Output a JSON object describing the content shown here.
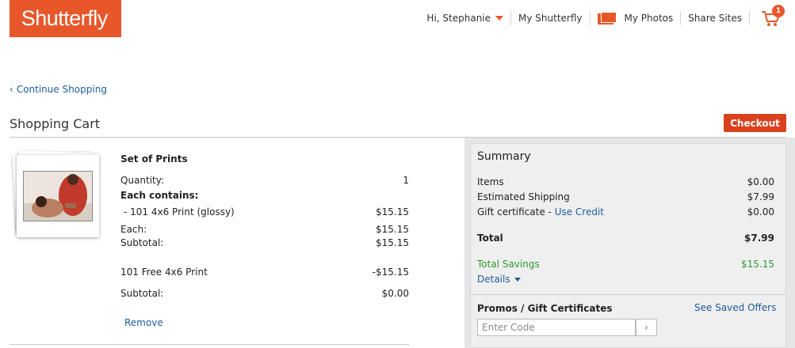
{
  "header": {
    "logo_text": "Shutterfly",
    "logo_mark": ".",
    "greeting": "Hi, Stephanie",
    "my_shutterfly": "My Shutterfly",
    "my_photos": "My Photos",
    "share_sites": "Share Sites",
    "cart_count": "1"
  },
  "continue_shopping": "Continue Shopping",
  "page_title": "Shopping Cart",
  "checkout_label": "Checkout",
  "item": {
    "title": "Set of Prints",
    "quantity_label": "Quantity:",
    "quantity_value": "1",
    "each_contains_label": "Each contains:",
    "line_label": "- 101 4x6 Print (glossy)",
    "line_value": "$15.15",
    "each_label": "Each:",
    "each_value": "$15.15",
    "subtotal_label": "Subtotal:",
    "subtotal_value": "$15.15",
    "free_label": "101 Free 4x6 Print",
    "free_value": "-$15.15",
    "subtotal2_label": "Subtotal:",
    "subtotal2_value": "$0.00",
    "remove_label": "Remove"
  },
  "summary": {
    "title": "Summary",
    "items_label": "Items",
    "items_value": "$0.00",
    "shipping_label": "Estimated Shipping",
    "shipping_value": "$7.99",
    "gift_label": "Gift certificate",
    "gift_sep": " - ",
    "use_credit": "Use Credit",
    "gift_value": "$0.00",
    "total_label": "Total",
    "total_value": "$7.99",
    "savings_label": "Total Savings",
    "savings_value": "$15.15",
    "details_label": "Details",
    "promo_title": "Promos / Gift Certificates",
    "saved_offers": "See Saved Offers",
    "promo_placeholder": "Enter Code",
    "promo_go": "›"
  },
  "colors": {
    "brand": "#e8572a",
    "checkout": "#d9421d",
    "link": "#1f5b9c",
    "savings": "#2e9a2e"
  },
  "icons": [
    "chevron-down-icon",
    "photos-icon",
    "cart-icon",
    "chevron-left-icon",
    "caret-down-icon",
    "chevron-right-icon"
  ]
}
